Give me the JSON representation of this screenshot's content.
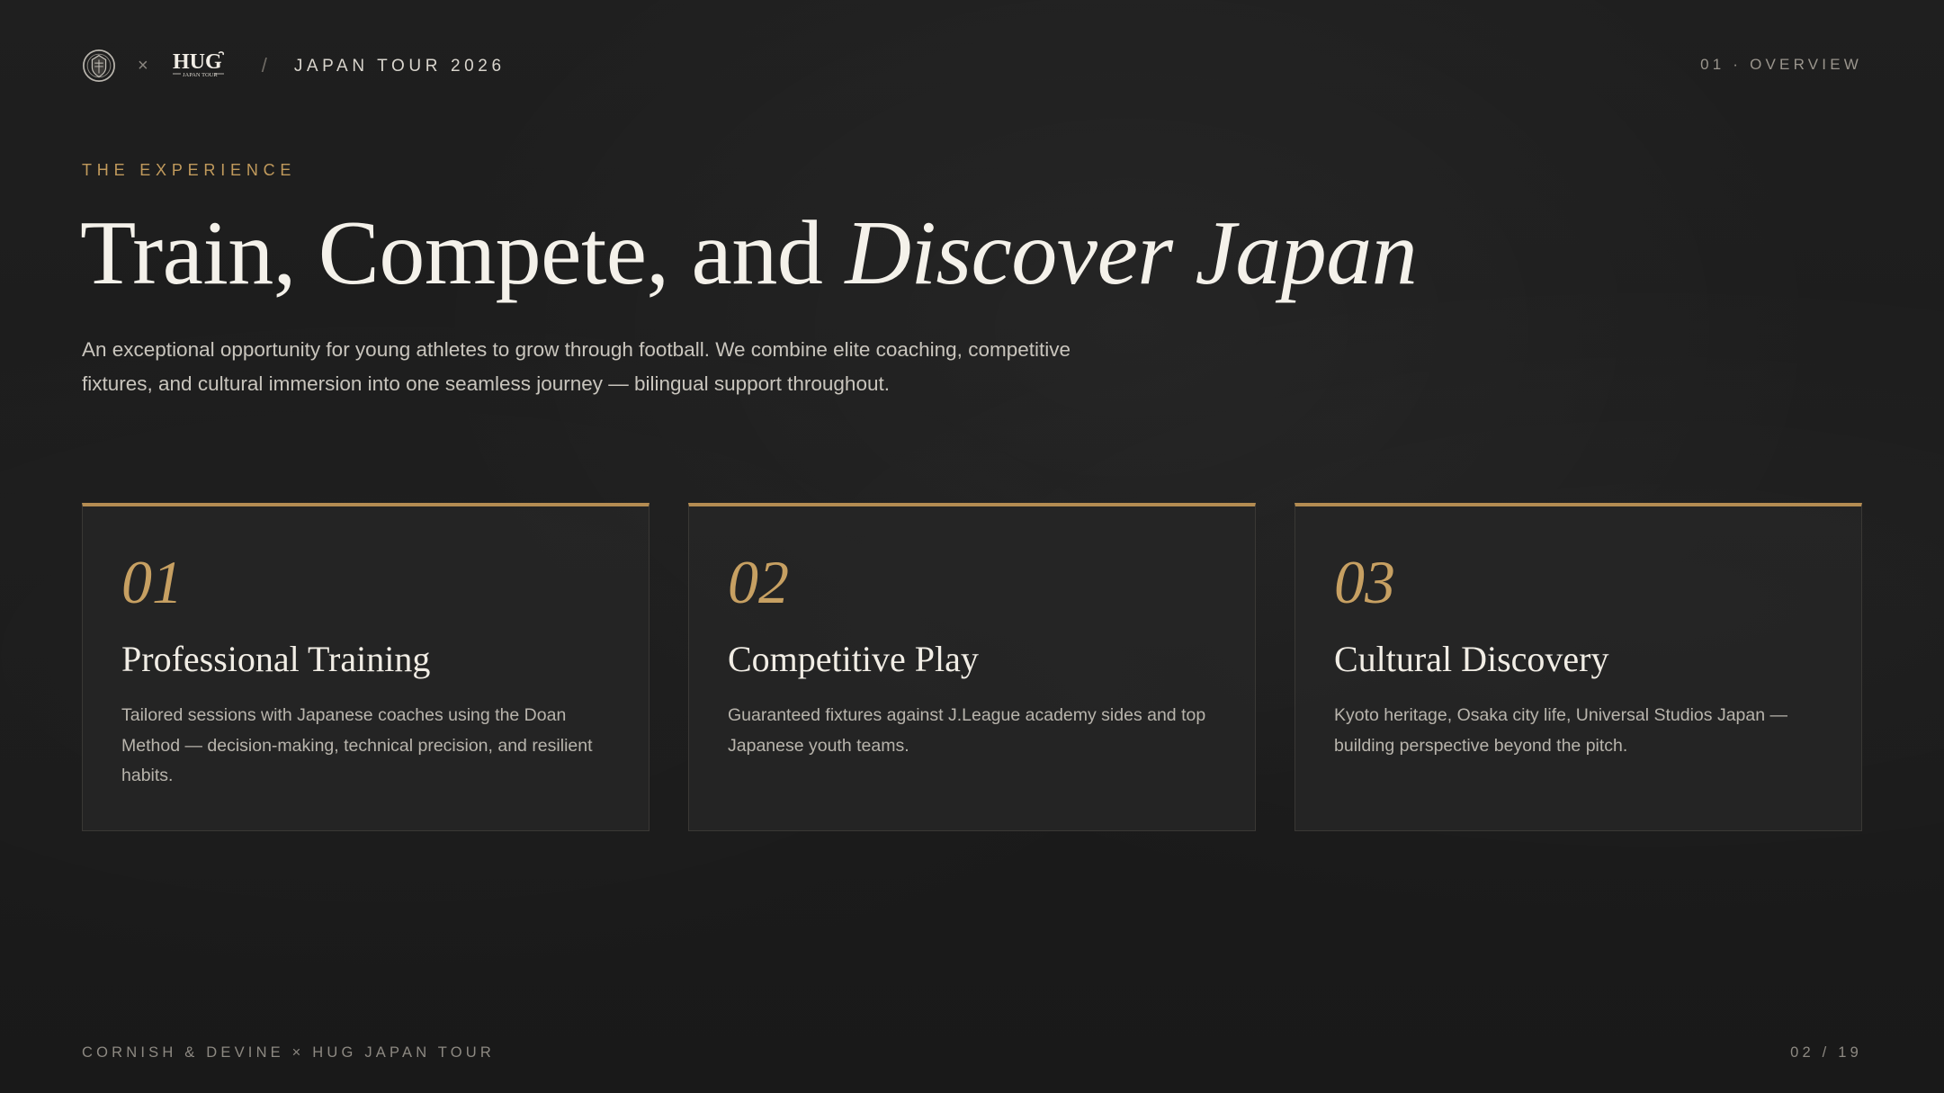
{
  "header": {
    "crest_icon": "club-crest-icon",
    "separator_times": "×",
    "logo_name": "hug-japan-tour-logo",
    "logo_main": "HUG",
    "logo_sub": "JAPAN TOUR",
    "divider": "/",
    "tour_title": "JAPAN TOUR 2026",
    "section_label": "01 · OVERVIEW"
  },
  "hero": {
    "eyebrow": "THE EXPERIENCE",
    "headline_regular": "Train, Compete, and ",
    "headline_italic": "Discover Japan",
    "intro": "An exceptional opportunity for young athletes to grow through football. We combine elite coaching, competitive fixtures, and cultural immersion into one seamless journey — bilingual support throughout."
  },
  "cards": [
    {
      "number": "01",
      "title": "Professional Training",
      "text": "Tailored sessions with Japanese coaches using the Doan Method — decision-making, technical precision, and resilient habits."
    },
    {
      "number": "02",
      "title": "Competitive Play",
      "text": "Guaranteed fixtures against J.League academy sides and top Japanese youth teams."
    },
    {
      "number": "03",
      "title": "Cultural Discovery",
      "text": "Kyoto heritage, Osaka city life, Universal Studios Japan — building perspective beyond the pitch."
    }
  ],
  "footer": {
    "left": "CORNISH & DEVINE × HUG JAPAN TOUR",
    "page_indicator": "02 / 19"
  },
  "colors": {
    "background": "#1c1c1c",
    "accent_gold": "#c19a5c",
    "card_border_top": "#b48c52",
    "text_primary": "#f4f1ea",
    "text_muted": "#8d8982"
  }
}
